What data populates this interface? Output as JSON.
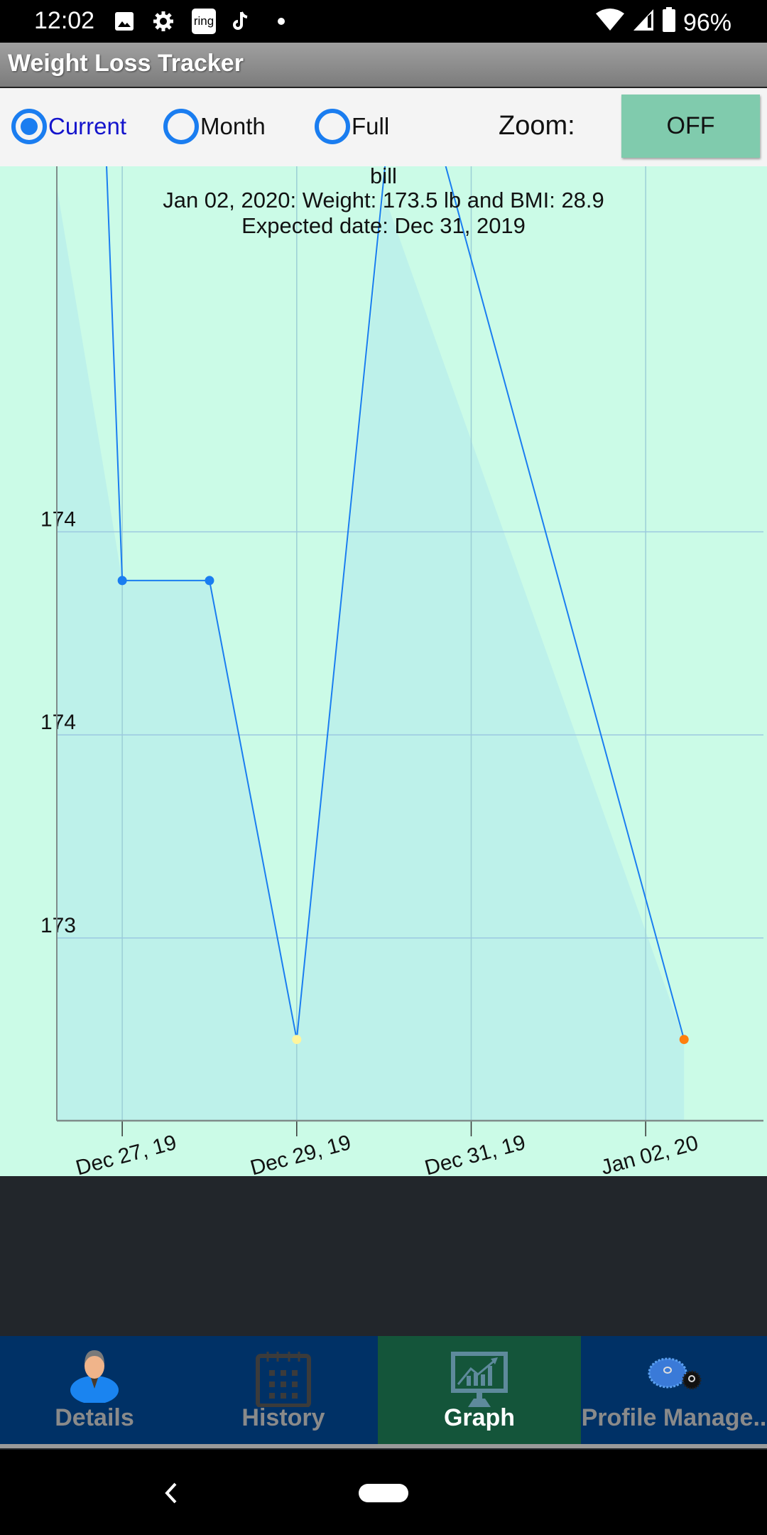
{
  "status_bar": {
    "time": "12:02",
    "notification_icons": [
      "image-icon",
      "settings-gear-icon",
      "ring-app-icon",
      "tiktok-icon",
      "dot-icon"
    ],
    "ring_text": "ring",
    "battery": "96%"
  },
  "app": {
    "title": "Weight Loss Tracker"
  },
  "controls": {
    "range_options": [
      {
        "label": "Current",
        "selected": true
      },
      {
        "label": "Month",
        "selected": false
      },
      {
        "label": "Full",
        "selected": false
      }
    ],
    "zoom_label": "Zoom:",
    "zoom_button": "OFF"
  },
  "colors": {
    "accent": "#1a7df0",
    "chart_bg": "#cbfbe7",
    "area_fill": "#bdf1ea",
    "line": "#1a7df0",
    "zoom_button": "#80cbad",
    "nav_bg": "#003166",
    "nav_active": "#14553a"
  },
  "chart_data": {
    "type": "line",
    "title": "bill",
    "subtitle_lines": [
      "Jan 02, 2020: Weight: 173.5 lb and BMI: 28.9",
      "Expected date: Dec 31, 2019"
    ],
    "xlabel": "",
    "ylabel": "",
    "x_tick_labels": [
      "Dec 27, 19",
      "Dec 29, 19",
      "Dec 31, 19",
      "Jan 02, 20"
    ],
    "x_tick_days": [
      0,
      2,
      4,
      6
    ],
    "y_tick_labels": [
      "174",
      "174",
      "173"
    ],
    "y_tick_values": [
      174.0,
      173.5,
      173.0
    ],
    "x_range_days": [
      -0.75,
      7.35
    ],
    "ylim": [
      172.55,
      174.9
    ],
    "grid": true,
    "note": "x in days relative to Dec 27, 2019; y in lb (estimated from gridlines)",
    "series": [
      {
        "name": "weight",
        "points": [
          {
            "x": -0.25,
            "y": 175.3
          },
          {
            "x": 0.0,
            "y": 173.88,
            "marker": "#1a7df0"
          },
          {
            "x": 1.0,
            "y": 173.88,
            "marker": "#1a7df0"
          },
          {
            "x": 2.0,
            "y": 172.75,
            "marker": "#fff59d"
          },
          {
            "x": 3.2,
            "y": 175.3
          },
          {
            "x": 6.44,
            "y": 172.75,
            "marker": "#ff7f0e"
          }
        ]
      },
      {
        "name": "trend-area",
        "points": [
          {
            "x": -0.75,
            "y": 174.85
          },
          {
            "x": 0.0,
            "y": 173.88
          },
          {
            "x": 1.0,
            "y": 173.88
          },
          {
            "x": 2.0,
            "y": 172.75
          },
          {
            "x": 3.0,
            "y": 174.83
          },
          {
            "x": 6.44,
            "y": 172.75
          }
        ]
      }
    ]
  },
  "bottom_nav": {
    "tabs": [
      {
        "label": "Details",
        "icon": "person-icon",
        "active": false
      },
      {
        "label": "History",
        "icon": "calendar-icon",
        "active": false
      },
      {
        "label": "Graph",
        "icon": "chart-monitor-icon",
        "active": true
      },
      {
        "label": "Profile Manage..",
        "icon": "gears-icon",
        "active": false
      }
    ]
  }
}
